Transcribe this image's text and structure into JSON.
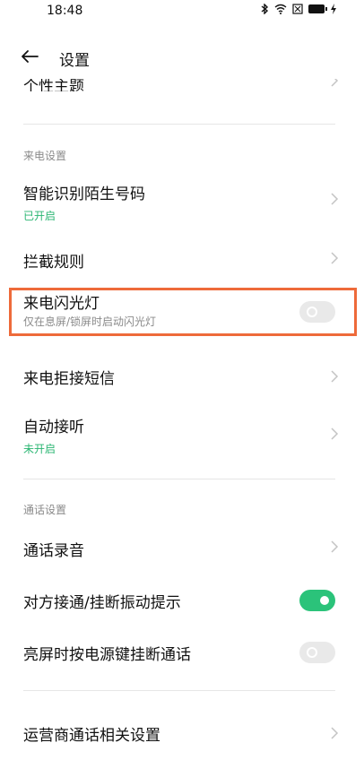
{
  "status_bar": {
    "time": "18:48",
    "icons": [
      "bluetooth-icon",
      "wifi-icon",
      "sim-icon",
      "battery-icon",
      "charging-icon"
    ]
  },
  "header": {
    "back_icon": "arrow-left-icon",
    "title": "设置"
  },
  "rows": {
    "theme": {
      "title": "个性主题"
    },
    "section_incoming": "来电设置",
    "unknown_number": {
      "title": "智能识别陌生号码",
      "status": "已开启"
    },
    "intercept_rules": {
      "title": "拦截规则"
    },
    "flash_light": {
      "title": "来电闪光灯",
      "subtitle": "仅在息屏/锁屏时启动闪光灯",
      "enabled": false
    },
    "reject_sms": {
      "title": "来电拒接短信"
    },
    "auto_answer": {
      "title": "自动接听",
      "status": "未开启"
    },
    "section_call": "通话设置",
    "call_recording": {
      "title": "通话录音"
    },
    "vibrate_hint": {
      "title": "对方接通/挂断振动提示",
      "enabled": true
    },
    "power_key_hangup": {
      "title": "亮屏时按电源键挂断通话",
      "enabled": false
    },
    "carrier_settings": {
      "title": "运营商通话相关设置"
    }
  },
  "colors": {
    "accent_green": "#2bc37a",
    "status_green": "#2bb673",
    "highlight_orange": "#ee6a3a"
  }
}
